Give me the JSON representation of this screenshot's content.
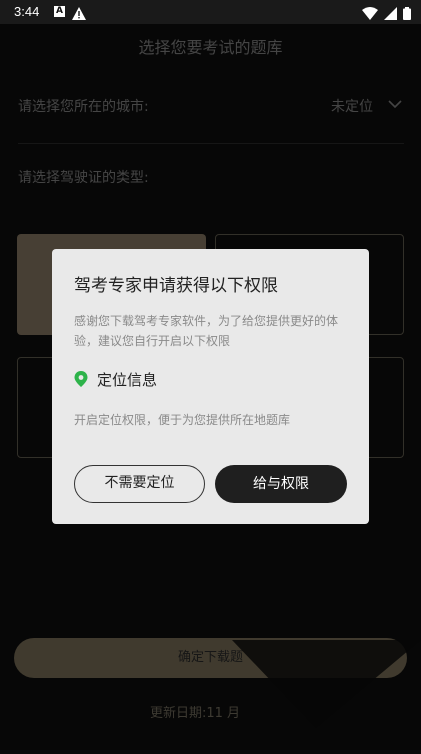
{
  "status_bar": {
    "time": "3:44",
    "notification_letter": "A"
  },
  "page": {
    "title": "选择您要考试的题库",
    "city_label": "请选择您所在的城市:",
    "city_value": "未定位",
    "license_type_label": "请选择驾驶证的类型:",
    "confirm_button": "确定下载题",
    "update_date": "更新日期:11 月"
  },
  "dialog": {
    "title": "驾考专家申请获得以下权限",
    "description": "感谢您下载驾考专家软件，为了给您提供更好的体验，建议您自行开启以下权限",
    "permission_name": "定位信息",
    "permission_desc": "开启定位权限，便于为您提供所在地题库",
    "deny_button": "不需要定位",
    "grant_button": "给与权限"
  },
  "colors": {
    "accent": "#6d6250",
    "location_green": "#2db34a"
  }
}
